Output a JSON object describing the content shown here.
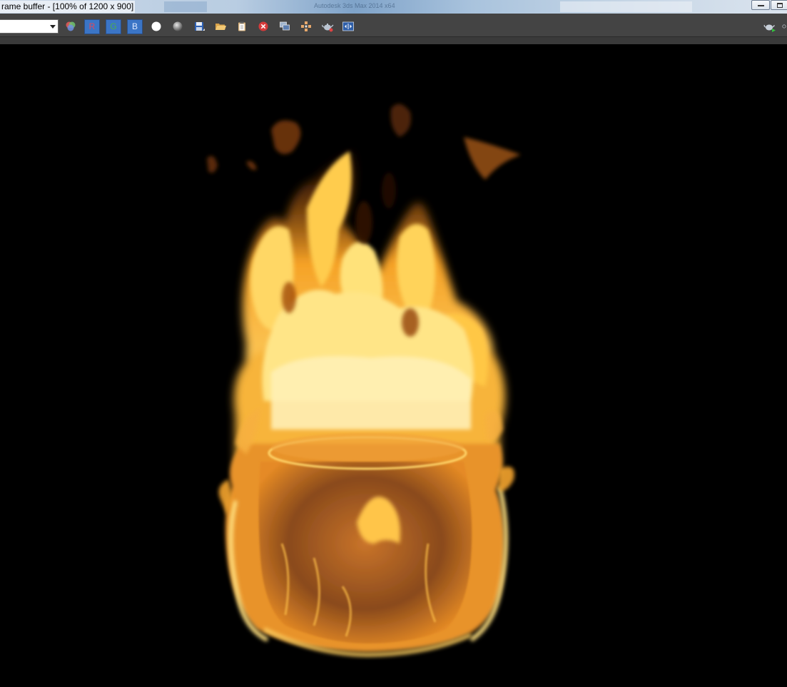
{
  "window": {
    "title": "rame buffer - [100% of 1200 x 900]",
    "background_text": [
      "Autodesk 3ds Max 2014 x64"
    ]
  },
  "toolbar": {
    "channel_select_value": "",
    "channels": {
      "r": "R",
      "g": "G",
      "b": "B"
    },
    "icons": [
      "color-channels-icon",
      "white-alpha-icon",
      "gray-alpha-icon",
      "save-image-icon",
      "open-folder-icon",
      "clipboard-icon",
      "clear-icon",
      "clone-window-icon",
      "track-mouse-icon",
      "render-teapot-icon",
      "compare-icon",
      "render-production-icon"
    ]
  },
  "colors": {
    "toolbar_bg": "#444444",
    "channel_button": "#3b75c6",
    "viewport_bg": "#000000",
    "flame_core": "#ffe27a",
    "flame_mid": "#f7a021",
    "flame_edge": "#b04a08"
  }
}
